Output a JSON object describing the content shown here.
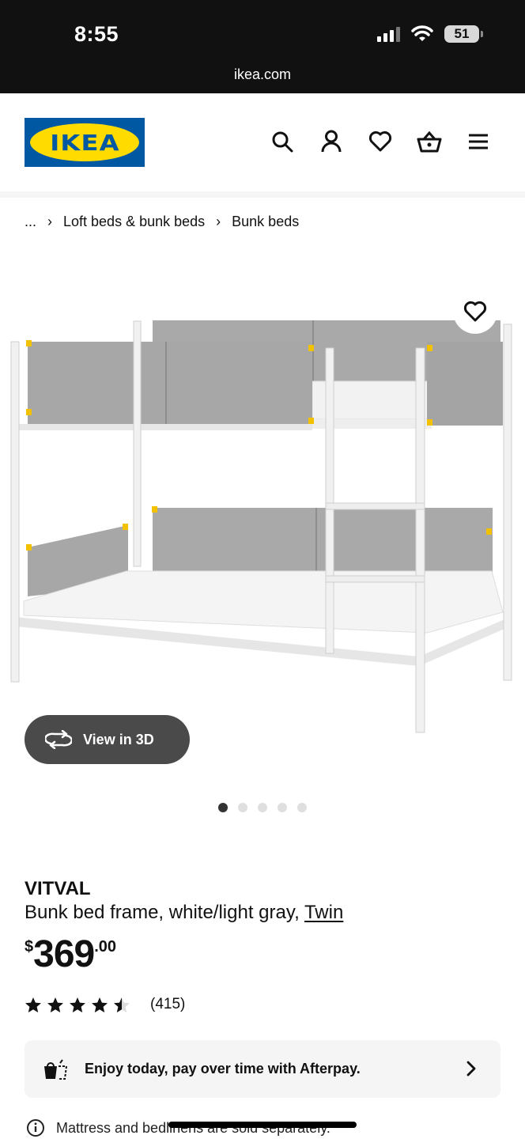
{
  "status_bar": {
    "time": "8:55",
    "battery": "51",
    "url": "ikea.com"
  },
  "header": {
    "logo_text": "IKEA",
    "icons": [
      "search-icon",
      "account-icon",
      "heart-icon",
      "cart-icon",
      "menu-icon"
    ]
  },
  "breadcrumb": {
    "ellipsis": "...",
    "separator": "›",
    "items": [
      "Loft beds & bunk beds",
      "Bunk beds"
    ]
  },
  "gallery": {
    "view3d_label": "View in 3D",
    "dots_total": 5,
    "active_dot": 0
  },
  "product": {
    "name": "VITVAL",
    "description": "Bunk bed frame, white/light gray,",
    "size_link": "Twin",
    "price": {
      "currency": "$",
      "integer": "369",
      "decimal": ".00"
    },
    "rating": {
      "stars": 4.5,
      "count": "(415)"
    }
  },
  "afterpay": {
    "text": "Enjoy today, pay over time with Afterpay."
  },
  "note": {
    "text": "Mattress and bedlinens are sold separately."
  },
  "colors": {
    "ikea_blue": "#0058a3",
    "ikea_yellow": "#ffdb00",
    "status_bar": "#111111",
    "pill_button": "#4a4a4a"
  }
}
